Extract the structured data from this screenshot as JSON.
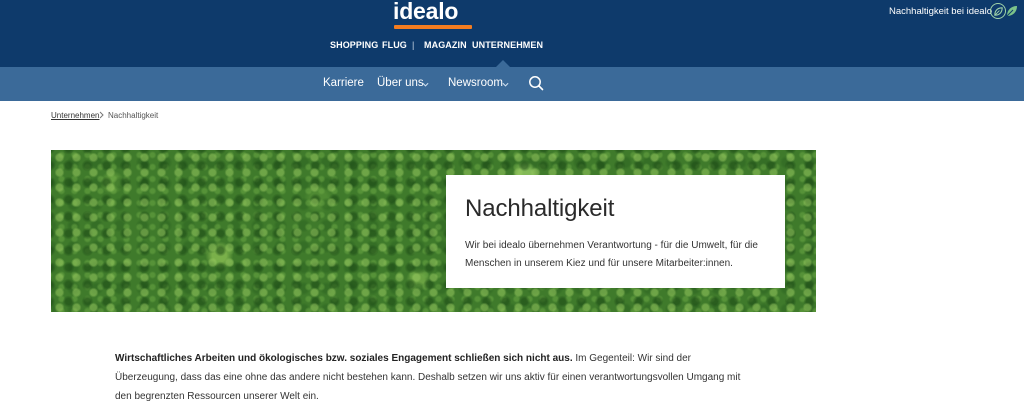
{
  "header": {
    "logo_text": "idealo",
    "brand_color": "#0e3a6b",
    "accent_color": "#f47d20",
    "sustainability_link": "Nachhaltigkeit bei idealo",
    "sustainability_icon": "leaf-icon"
  },
  "main_nav": {
    "items": [
      {
        "label": "SHOPPING"
      },
      {
        "label": "FLUG"
      },
      {
        "label": "|"
      },
      {
        "label": "MAGAZIN"
      },
      {
        "label": "UNTERNEHMEN",
        "active": true
      }
    ]
  },
  "sub_nav": {
    "background": "#3b6a99",
    "items": [
      {
        "label": "Karriere"
      },
      {
        "label": "Über uns",
        "has_dropdown": true
      },
      {
        "label": "Newsroom",
        "has_dropdown": true
      }
    ],
    "search_icon": "search-icon"
  },
  "breadcrumb": {
    "parent": "Unternehmen",
    "separator": ">",
    "current": "Nachhaltigkeit"
  },
  "hero": {
    "title": "Nachhaltigkeit",
    "text": "Wir bei idealo übernehmen Verantwortung - für die Umwelt, für die Menschen in unserem Kiez und für unsere Mitarbeiter:innen."
  },
  "intro": {
    "bold": "Wirtschaftliches Arbeiten und ökologisches bzw. soziales Engagement schließen sich nicht aus.",
    "text": " Im Gegenteil: Wir sind der Überzeugung, dass das eine ohne das andere nicht bestehen kann. Deshalb setzen wir uns aktiv für einen verantwortungsvollen Umgang mit den begrenzten Ressourcen unserer Welt ein."
  }
}
